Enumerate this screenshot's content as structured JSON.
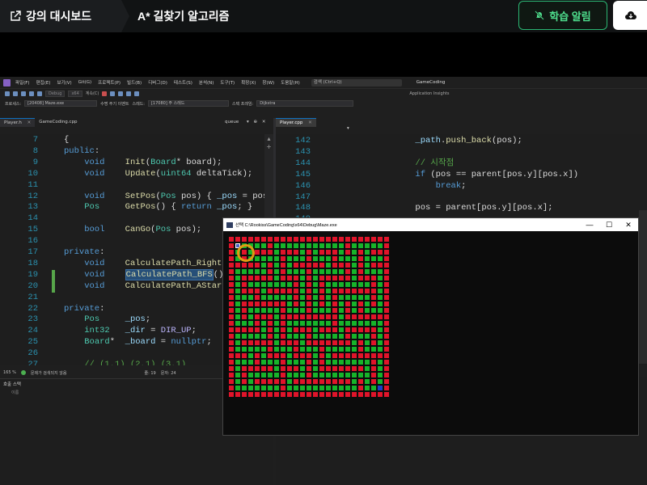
{
  "header": {
    "dashboard_label": "강의 대시보드",
    "lecture_title": "A* 길찾기 알고리즘",
    "alert_button": "학습 알림"
  },
  "ide": {
    "menu": [
      "파일(F)",
      "편집(E)",
      "보기(V)",
      "Git(G)",
      "프로젝트(P)",
      "빌드(B)",
      "디버그(D)",
      "테스트(S)",
      "분석(N)",
      "도구(T)",
      "확장(X)",
      "창(W)",
      "도움말(H)"
    ],
    "search_placeholder": "검색 (Ctrl+Q)",
    "solution_name": "GameCoding",
    "toolbar": {
      "config": "Debug",
      "platform": "x64",
      "continue": "계속(C)",
      "app_insights": "Application Insights"
    },
    "process_bar": {
      "process_label": "프로세스:",
      "process_value": "[20408] Maze.exe",
      "lifecycle": "수명 주기 이벤트",
      "thread_label": "스레드:",
      "thread_value": "[17080] 주 스레드",
      "stack_label": "스택 프레임:",
      "stack_value": "Dijkstra"
    },
    "left_tabs": {
      "active": "Player.h",
      "other": "GameCoding.cpp",
      "dropdown": "queue"
    },
    "right_tab": "Player.cpp",
    "left_status": {
      "zoom": "165 %",
      "issues": "문제가 검색되지 않음",
      "line": "줄: 19",
      "char": "문자: 24"
    },
    "callstack": {
      "title": "호출 스택",
      "column": "이름"
    }
  },
  "left_code": {
    "line_numbers": [
      "7",
      "8",
      "9",
      "10",
      "11",
      "12",
      "13",
      "14",
      "15",
      "16",
      "17",
      "18",
      "19",
      "20",
      "21",
      "22",
      "23",
      "24",
      "25",
      "26",
      "27"
    ],
    "lines": [
      [
        {
          "t": "{",
          "c": ""
        }
      ],
      [
        {
          "t": "public",
          "c": "kw"
        },
        {
          "t": ":",
          "c": ""
        }
      ],
      [
        {
          "t": "    void",
          "c": "kw"
        },
        {
          "t": "    ",
          "c": ""
        },
        {
          "t": "Init",
          "c": "fn"
        },
        {
          "t": "(",
          "c": ""
        },
        {
          "t": "Board",
          "c": "ty"
        },
        {
          "t": "* board);",
          "c": ""
        }
      ],
      [
        {
          "t": "    void",
          "c": "kw"
        },
        {
          "t": "    ",
          "c": ""
        },
        {
          "t": "Update",
          "c": "fn"
        },
        {
          "t": "(",
          "c": ""
        },
        {
          "t": "uint64",
          "c": "ty"
        },
        {
          "t": " deltaTick);",
          "c": ""
        }
      ],
      [],
      [
        {
          "t": "    void",
          "c": "kw"
        },
        {
          "t": "    ",
          "c": ""
        },
        {
          "t": "SetPos",
          "c": "fn"
        },
        {
          "t": "(",
          "c": ""
        },
        {
          "t": "Pos",
          "c": "ty"
        },
        {
          "t": " pos) { ",
          "c": ""
        },
        {
          "t": "_pos",
          "c": "mem"
        },
        {
          "t": " = pos; }",
          "c": ""
        }
      ],
      [
        {
          "t": "    ",
          "c": ""
        },
        {
          "t": "Pos",
          "c": "ty"
        },
        {
          "t": "     ",
          "c": ""
        },
        {
          "t": "GetPos",
          "c": "fn"
        },
        {
          "t": "() { ",
          "c": ""
        },
        {
          "t": "return",
          "c": "kw"
        },
        {
          "t": " ",
          "c": ""
        },
        {
          "t": "_pos",
          "c": "mem"
        },
        {
          "t": "; }",
          "c": ""
        }
      ],
      [],
      [
        {
          "t": "    bool",
          "c": "kw"
        },
        {
          "t": "    ",
          "c": ""
        },
        {
          "t": "CanGo",
          "c": "fn"
        },
        {
          "t": "(",
          "c": ""
        },
        {
          "t": "Pos",
          "c": "ty"
        },
        {
          "t": " pos);",
          "c": ""
        }
      ],
      [],
      [
        {
          "t": "private",
          "c": "kw"
        },
        {
          "t": ":",
          "c": ""
        }
      ],
      [
        {
          "t": "    void",
          "c": "kw"
        },
        {
          "t": "    ",
          "c": ""
        },
        {
          "t": "CalculatePath_RightHand",
          "c": "fn"
        },
        {
          "t": "();",
          "c": ""
        }
      ],
      [
        {
          "t": "    void",
          "c": "kw"
        },
        {
          "t": "    ",
          "c": ""
        },
        {
          "t": "CalculatePath_BFS",
          "c": "fn hl"
        },
        {
          "t": "();",
          "c": ""
        }
      ],
      [
        {
          "t": "    void",
          "c": "kw"
        },
        {
          "t": "    ",
          "c": ""
        },
        {
          "t": "CalculatePath_AStar",
          "c": "fn"
        },
        {
          "t": "();",
          "c": ""
        }
      ],
      [],
      [
        {
          "t": "private",
          "c": "kw"
        },
        {
          "t": ":",
          "c": ""
        }
      ],
      [
        {
          "t": "    ",
          "c": ""
        },
        {
          "t": "Pos",
          "c": "ty"
        },
        {
          "t": "     ",
          "c": ""
        },
        {
          "t": "_pos",
          "c": "mem"
        },
        {
          "t": ";",
          "c": ""
        }
      ],
      [
        {
          "t": "    ",
          "c": ""
        },
        {
          "t": "int32",
          "c": "ty"
        },
        {
          "t": "   ",
          "c": ""
        },
        {
          "t": "_dir",
          "c": "mem"
        },
        {
          "t": " = ",
          "c": ""
        },
        {
          "t": "DIR_UP",
          "c": "mac"
        },
        {
          "t": ";",
          "c": ""
        }
      ],
      [
        {
          "t": "    ",
          "c": ""
        },
        {
          "t": "Board",
          "c": "ty"
        },
        {
          "t": "*  ",
          "c": ""
        },
        {
          "t": "_board",
          "c": "mem"
        },
        {
          "t": " = ",
          "c": ""
        },
        {
          "t": "nullptr",
          "c": "kw"
        },
        {
          "t": ";",
          "c": ""
        }
      ],
      [],
      [
        {
          "t": "    // (1,1) (2,1) (3,1)",
          "c": "cm"
        }
      ]
    ]
  },
  "right_code": {
    "line_numbers": [
      "142",
      "143",
      "144",
      "145",
      "146",
      "147",
      "148",
      "149"
    ],
    "lines": [
      [
        {
          "t": "        ",
          "c": ""
        },
        {
          "t": "_path",
          "c": "mem"
        },
        {
          "t": ".",
          "c": ""
        },
        {
          "t": "push_back",
          "c": "fn"
        },
        {
          "t": "(pos);",
          "c": ""
        }
      ],
      [],
      [
        {
          "t": "        // 시작점",
          "c": "cm"
        }
      ],
      [
        {
          "t": "        ",
          "c": ""
        },
        {
          "t": "if",
          "c": "kw"
        },
        {
          "t": " (pos == parent[pos.y][pos.x])",
          "c": ""
        }
      ],
      [
        {
          "t": "            ",
          "c": ""
        },
        {
          "t": "break",
          "c": "kw"
        },
        {
          "t": ";",
          "c": ""
        }
      ],
      [],
      [
        {
          "t": "        pos = parent[pos.y][pos.x];",
          "c": ""
        }
      ],
      []
    ]
  },
  "maze_window": {
    "title": "선택 C:\\Rookiss\\GameCoding\\x64\\Debug\\Maze.exe",
    "buttons": [
      "—",
      "☐",
      "✕"
    ],
    "size": 25,
    "colors": {
      "wall": "#e0142a",
      "path": "#17b32a",
      "player": "#4a63c4",
      "goal": "#1a3fc9",
      "ring": "#e09a12"
    },
    "player": [
      1,
      1
    ],
    "goal": [
      23,
      23
    ],
    "rows": [
      "XXXXXXXXXXXXXXXXXXXXXXXXX",
      "X.....X...........X.....X",
      "X.X.XXX.XXX.X.XXX.X.X.XXX",
      "X.X.....X...X...X...X...X",
      "XXXXX.X.X.XXXXX.XXX.X.XXX",
      "X.....X.X...X.....X.X...X",
      "X.XXXXX.XXX.X.XXXXX.XXX.X",
      "X.X.......X.X.X.......X.X",
      "X.XXX.XXXXX.X.X.XXXXXXX.X",
      "X...X.....X.X.X.X.....X.X",
      "X.XXXXXXX.X.X.X.X.X.X.X.X",
      "X.X.....X...X...X.X.X...X",
      "X.X.XXX.XXXXXXXXX.XXXXXXX",
      "X...X.X.X.......X.......X",
      "XXXXX.X.X.XXX.XXX.XXXXX.X",
      "X.....X.X...X.....X...X.X",
      "X.XXXXX.XXX.XXXXXXX.X.X.X",
      "X.....X...X...X.....X...X",
      "XXX.X.XXX.XXX.X.XXXXXXXXX",
      "X...X...X...X.X.......X.X",
      "X.XXXXX.XXX.X.XXXXXXX.X.X",
      "X.X.....X...X.........X.X",
      "X.X.XXXXX.XXXXXXXXX.X.X.X",
      "X.......X...........X...X",
      "XXXXXXXXXXXXXXXXXXXXXXXXX"
    ]
  }
}
